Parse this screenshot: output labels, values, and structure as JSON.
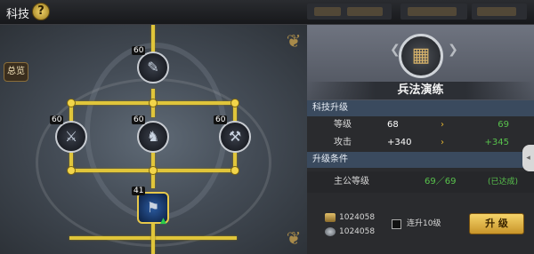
{
  "header": {
    "title": "科技",
    "help_icon": "question-icon"
  },
  "tree": {
    "overview_label": "总览",
    "nodes": [
      {
        "level": "60",
        "name": "",
        "icon": "tome-icon"
      },
      {
        "level": "60",
        "name": "",
        "icon": "crossed-swords-icon"
      },
      {
        "level": "60",
        "name": "",
        "icon": "armored-knight-icon"
      },
      {
        "level": "60",
        "name": "",
        "icon": "warhammer-icon"
      },
      {
        "level": "41",
        "name": "",
        "icon": "blue-banner-icon",
        "selected": true
      }
    ],
    "line_color": "#e0c53a"
  },
  "panel": {
    "tech_name": "兵法演练",
    "section_upgrade": "科技升级",
    "rows": [
      {
        "key": "等级",
        "current": "68",
        "next": "69"
      },
      {
        "key": "攻击",
        "current": "+340",
        "next": "+345"
      }
    ],
    "section_requirements": "升级条件",
    "requirement": {
      "key": "主公等级",
      "value": "69／69",
      "status": "(已达成)"
    },
    "costs": [
      {
        "icon": "scroll-icon",
        "amount": "1024058"
      },
      {
        "icon": "ore-icon",
        "amount": "1024058"
      }
    ],
    "checkbox_label": "连升10级",
    "upgrade_button": "升 级"
  },
  "colors": {
    "accent_gold": "#e6c84a",
    "positive_green": "#58c24c",
    "section_blue": "#3a4a5e"
  }
}
